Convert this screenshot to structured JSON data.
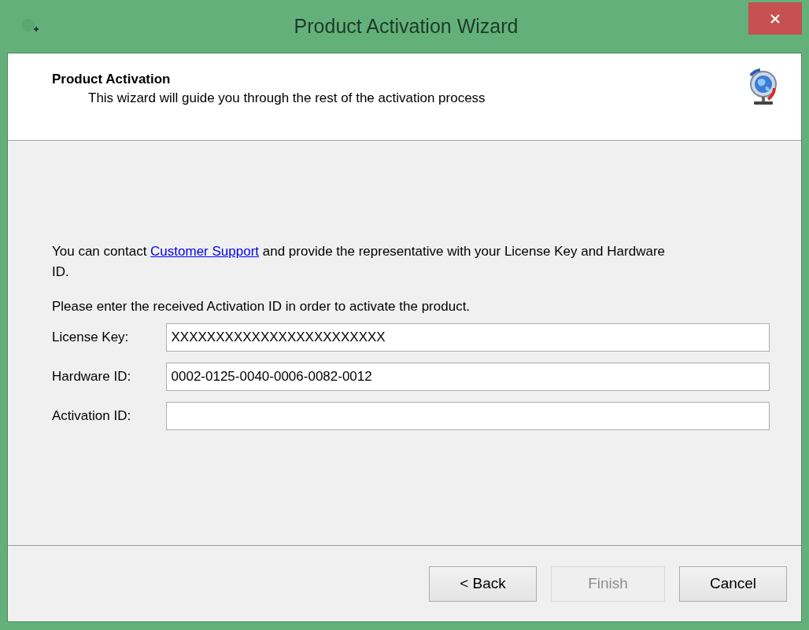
{
  "window": {
    "title": "Product Activation Wizard"
  },
  "header": {
    "title": "Product Activation",
    "subtitle": "This wizard will guide you through the rest of the activation process"
  },
  "contact": {
    "before": "You can contact ",
    "link": "Customer Support",
    "after": " and provide the representative with your License Key and Hardware ID."
  },
  "instruction": "Please enter the received Activation ID in order to activate the product.",
  "fields": [
    {
      "label": "License Key:",
      "value": "XXXXXXXXXXXXXXXXXXXXXXXX"
    },
    {
      "label": "Hardware ID:",
      "value": "0002-0125-0040-0006-0082-0012"
    },
    {
      "label": "Activation ID:"
    }
  ],
  "buttons": [
    {
      "label": "< Back",
      "disabled": false
    },
    {
      "label": "Finish",
      "disabled": true
    },
    {
      "label": "Cancel",
      "disabled": false
    }
  ]
}
